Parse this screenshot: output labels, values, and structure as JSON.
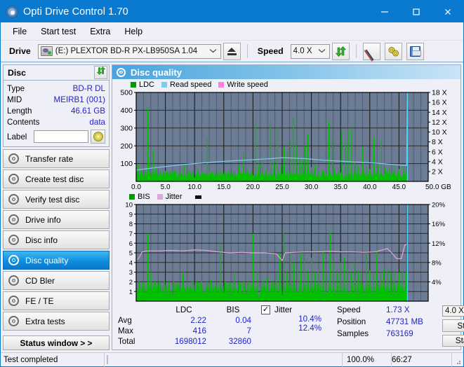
{
  "window": {
    "title": "Opti Drive Control 1.70",
    "icon": "disc-icon",
    "minimize": "–",
    "maximize": "□",
    "close": "✕"
  },
  "menu": {
    "items": [
      {
        "label": "File"
      },
      {
        "label": "Start test"
      },
      {
        "label": "Extra"
      },
      {
        "label": "Help"
      }
    ]
  },
  "toolbar": {
    "drive_label": "Drive",
    "drive_value": "(E:)   PLEXTOR BD-R  PX-LB950SA 1.04",
    "eject_icon": "eject-icon",
    "speed_label": "Speed",
    "speed_value": "4.0 X",
    "refresh_icon": "refresh-icon",
    "eraser_icon": "eraser-icon",
    "tools_icon": "gears-icon",
    "save_icon": "save-icon",
    "chevron": "⌄"
  },
  "sidebar": {
    "disc_panel": {
      "title": "Disc",
      "refresh_icon": "refresh-icon",
      "rows": [
        {
          "key": "Type",
          "value": "BD-R DL"
        },
        {
          "key": "MID",
          "value": "MEIRB1 (001)"
        },
        {
          "key": "Length",
          "value": "46.61 GB"
        },
        {
          "key": "Contents",
          "value": "data"
        }
      ],
      "label_key": "Label",
      "label_value": "",
      "label_placeholder": "",
      "cd_icon": "cd-icon"
    },
    "nav": [
      {
        "label": "Transfer rate",
        "icon": "disc-icon",
        "active": false
      },
      {
        "label": "Create test disc",
        "icon": "disc-icon",
        "active": false
      },
      {
        "label": "Verify test disc",
        "icon": "disc-icon",
        "active": false
      },
      {
        "label": "Drive info",
        "icon": "disc-icon",
        "active": false
      },
      {
        "label": "Disc info",
        "icon": "disc-icon",
        "active": false
      },
      {
        "label": "Disc quality",
        "icon": "disc-icon",
        "active": true
      },
      {
        "label": "CD Bler",
        "icon": "disc-icon",
        "active": false
      },
      {
        "label": "FE / TE",
        "icon": "disc-icon",
        "active": false
      },
      {
        "label": "Extra tests",
        "icon": "disc-icon",
        "active": false
      }
    ],
    "status_window": "Status window > >"
  },
  "main": {
    "title": "Disc quality",
    "icon": "disc-icon"
  },
  "stats": {
    "columns": [
      "LDC",
      "BIS"
    ],
    "rows": [
      {
        "key": "Avg",
        "ldc": "2.22",
        "bis": "0.04"
      },
      {
        "key": "Max",
        "ldc": "416",
        "bis": "7"
      },
      {
        "key": "Total",
        "ldc": "1698012",
        "bis": "32860"
      }
    ],
    "jitter": {
      "checked": true,
      "check_glyph": "✓",
      "label": "Jitter",
      "avg": "10.4%",
      "max": "12.4%"
    },
    "right": [
      {
        "key": "Speed",
        "value": "1.73 X"
      },
      {
        "key": "Position",
        "value": "47731 MB"
      },
      {
        "key": "Samples",
        "value": "763169"
      }
    ],
    "speed_select": "4.0 X",
    "speed_chevron": "⌄",
    "start_full": "Start full",
    "start_part": "Start part"
  },
  "statusbar": {
    "text": "Test completed",
    "percent_label": "100.0%",
    "percent_value": 100,
    "time": "66:27"
  },
  "chart_data": [
    {
      "type": "area",
      "name": "ldc-chart",
      "title": "",
      "xlabel": "GB",
      "ylabel": "",
      "xlim": [
        0,
        50
      ],
      "ylim": [
        0,
        500
      ],
      "xticks": [
        "0.0",
        "5.0",
        "10.0",
        "15.0",
        "20.0",
        "25.0",
        "30.0",
        "35.0",
        "40.0",
        "45.0",
        "50.0 GB"
      ],
      "yticks": [
        "100",
        "200",
        "300",
        "400",
        "500"
      ],
      "y2lim": [
        0,
        18
      ],
      "y2ticks": [
        "2 X",
        "4 X",
        "6 X",
        "8 X",
        "10 X",
        "12 X",
        "14 X",
        "16 X",
        "18 X"
      ],
      "grid": true,
      "legend_position": "top",
      "legend": [
        {
          "name": "LDC",
          "color": "#009900"
        },
        {
          "name": "Read speed",
          "color": "#7ecbf0"
        },
        {
          "name": "Write speed",
          "color": "#ff7fe0"
        }
      ],
      "series": [
        {
          "name": "LDC",
          "color": "#00c000",
          "kind": "spikes",
          "baseline": 30,
          "peaks": [
            [
              0.3,
              95
            ],
            [
              0.8,
              60
            ],
            [
              1.4,
              70
            ],
            [
              2.0,
              415
            ],
            [
              2.3,
              120
            ],
            [
              2.9,
              180
            ],
            [
              3.4,
              75
            ],
            [
              4.1,
              55
            ],
            [
              5.0,
              60
            ],
            [
              5.8,
              50
            ],
            [
              6.6,
              65
            ],
            [
              7.4,
              45
            ],
            [
              8.2,
              90
            ],
            [
              9.0,
              55
            ],
            [
              9.8,
              60
            ],
            [
              10.6,
              70
            ],
            [
              11.4,
              50
            ],
            [
              12.2,
              245
            ],
            [
              12.9,
              60
            ],
            [
              13.6,
              55
            ],
            [
              14.4,
              70
            ],
            [
              15.2,
              50
            ],
            [
              16.0,
              60
            ],
            [
              16.8,
              55
            ],
            [
              17.6,
              95
            ],
            [
              18.4,
              160
            ],
            [
              19.0,
              70
            ],
            [
              19.7,
              60
            ],
            [
              20.4,
              330
            ],
            [
              21.0,
              100
            ],
            [
              21.6,
              120
            ],
            [
              22.2,
              60
            ],
            [
              23.0,
              345
            ],
            [
              23.6,
              110
            ],
            [
              24.2,
              300
            ],
            [
              24.8,
              90
            ],
            [
              25.3,
              190
            ],
            [
              25.9,
              170
            ],
            [
              26.4,
              230
            ],
            [
              26.9,
              360
            ],
            [
              27.4,
              210
            ],
            [
              28.0,
              150
            ],
            [
              28.4,
              115
            ],
            [
              28.9,
              200
            ],
            [
              29.4,
              265
            ],
            [
              30.0,
              80
            ],
            [
              30.6,
              90
            ],
            [
              31.2,
              70
            ],
            [
              32.0,
              60
            ],
            [
              33.0,
              340
            ],
            [
              33.6,
              240
            ],
            [
              34.0,
              70
            ],
            [
              34.6,
              70
            ],
            [
              35.2,
              285
            ],
            [
              35.8,
              215
            ],
            [
              36.3,
              290
            ],
            [
              36.9,
              295
            ],
            [
              37.4,
              120
            ],
            [
              38.0,
              90
            ],
            [
              38.8,
              190
            ],
            [
              39.4,
              80
            ],
            [
              40.0,
              70
            ],
            [
              40.7,
              250
            ],
            [
              41.4,
              90
            ],
            [
              42.0,
              240
            ],
            [
              42.6,
              80
            ],
            [
              43.4,
              80
            ],
            [
              44.2,
              100
            ],
            [
              45.0,
              70
            ],
            [
              45.8,
              90
            ],
            [
              46.3,
              60
            ]
          ]
        },
        {
          "name": "Read speed",
          "color": "#7ecbf0",
          "kind": "line",
          "points": [
            [
              0.0,
              2.3
            ],
            [
              2.0,
              2.6
            ],
            [
              5.0,
              3.0
            ],
            [
              8.0,
              3.4
            ],
            [
              11.0,
              3.7
            ],
            [
              14.0,
              4.0
            ],
            [
              17.0,
              4.2
            ],
            [
              20.0,
              4.4
            ],
            [
              23.0,
              4.6
            ],
            [
              25.0,
              4.8
            ],
            [
              27.0,
              4.7
            ],
            [
              29.0,
              4.6
            ],
            [
              32.0,
              4.3
            ],
            [
              35.0,
              4.1
            ],
            [
              38.0,
              3.9
            ],
            [
              41.0,
              3.7
            ],
            [
              44.0,
              3.4
            ],
            [
              46.3,
              3.2
            ],
            [
              46.4,
              18.0
            ]
          ]
        }
      ]
    },
    {
      "type": "area",
      "name": "bis-jitter-chart",
      "title": "",
      "xlabel": "GB",
      "ylabel": "",
      "xlim": [
        0,
        50
      ],
      "ylim": [
        0,
        10
      ],
      "xticks": [
        "0.0",
        "5.0",
        "10.0",
        "15.0",
        "20.0",
        "25.0",
        "30.0",
        "35.0",
        "40.0",
        "45.0",
        "50.0 GB"
      ],
      "yticks": [
        "1",
        "2",
        "3",
        "4",
        "5",
        "6",
        "7",
        "8",
        "9",
        "10"
      ],
      "y2lim": [
        0,
        20
      ],
      "y2ticks": [
        "4%",
        "8%",
        "12%",
        "16%",
        "20%"
      ],
      "grid": true,
      "legend_position": "top",
      "legend": [
        {
          "name": "BIS",
          "color": "#009900"
        },
        {
          "name": "Jitter",
          "color": "#e0a8d8"
        }
      ],
      "series": [
        {
          "name": "BIS",
          "color": "#00c000",
          "kind": "spikes",
          "baseline": 1.05,
          "peaks": [
            [
              0.5,
              2.1
            ],
            [
              1.2,
              2.0
            ],
            [
              2.0,
              7.0
            ],
            [
              2.5,
              3.0
            ],
            [
              3.2,
              2.1
            ],
            [
              4.0,
              2.0
            ],
            [
              4.8,
              2.2
            ],
            [
              5.6,
              2.0
            ],
            [
              6.4,
              2.1
            ],
            [
              7.2,
              2.0
            ],
            [
              8.0,
              3.0
            ],
            [
              8.8,
              2.0
            ],
            [
              9.6,
              2.2
            ],
            [
              10.4,
              2.0
            ],
            [
              11.2,
              2.1
            ],
            [
              12.0,
              2.0
            ],
            [
              12.8,
              2.2
            ],
            [
              13.6,
              2.0
            ],
            [
              14.4,
              6.0
            ],
            [
              15.2,
              2.1
            ],
            [
              16.0,
              2.0
            ],
            [
              16.8,
              3.0
            ],
            [
              17.6,
              2.0
            ],
            [
              18.4,
              2.2
            ],
            [
              19.2,
              2.0
            ],
            [
              20.0,
              7.0
            ],
            [
              20.8,
              3.0
            ],
            [
              21.6,
              2.1
            ],
            [
              22.4,
              2.5
            ],
            [
              23.2,
              2.0
            ],
            [
              24.0,
              3.0
            ],
            [
              24.6,
              5.0
            ],
            [
              25.2,
              7.2
            ],
            [
              25.8,
              3.0
            ],
            [
              26.4,
              5.2
            ],
            [
              27.0,
              4.0
            ],
            [
              27.6,
              3.2
            ],
            [
              28.2,
              5.0
            ],
            [
              28.8,
              4.2
            ],
            [
              29.4,
              3.0
            ],
            [
              30.0,
              4.5
            ],
            [
              30.6,
              3.0
            ],
            [
              31.2,
              3.2
            ],
            [
              32.0,
              5.2
            ],
            [
              32.6,
              3.0
            ],
            [
              33.2,
              7.2
            ],
            [
              33.8,
              4.0
            ],
            [
              34.4,
              3.0
            ],
            [
              35.0,
              4.0
            ],
            [
              35.6,
              4.5
            ],
            [
              36.2,
              3.5
            ],
            [
              36.8,
              3.0
            ],
            [
              37.4,
              4.0
            ],
            [
              38.0,
              3.2
            ],
            [
              38.6,
              3.0
            ],
            [
              39.4,
              5.0
            ],
            [
              40.0,
              3.2
            ],
            [
              40.6,
              3.0
            ],
            [
              41.2,
              5.2
            ],
            [
              41.8,
              3.0
            ],
            [
              42.4,
              3.2
            ],
            [
              43.0,
              3.5
            ],
            [
              43.6,
              3.0
            ],
            [
              44.2,
              3.2
            ],
            [
              45.0,
              3.0
            ],
            [
              45.6,
              3.2
            ],
            [
              46.2,
              3.0
            ]
          ],
          "fill_to": 1.45
        },
        {
          "name": "Jitter",
          "color": "#e0a8d8",
          "kind": "line",
          "points": [
            [
              0.2,
              4.3
            ],
            [
              0.6,
              4.6
            ],
            [
              1.0,
              5.1
            ],
            [
              2.0,
              5.2
            ],
            [
              4.0,
              5.2
            ],
            [
              6.0,
              5.25
            ],
            [
              8.0,
              5.2
            ],
            [
              10.0,
              5.3
            ],
            [
              12.0,
              5.25
            ],
            [
              14.0,
              5.1
            ],
            [
              16.0,
              5.0
            ],
            [
              18.0,
              5.05
            ],
            [
              20.0,
              5.0
            ],
            [
              22.0,
              5.0
            ],
            [
              24.0,
              4.9
            ],
            [
              25.0,
              4.2
            ],
            [
              25.5,
              5.0
            ],
            [
              27.0,
              5.05
            ],
            [
              29.0,
              5.1
            ],
            [
              31.0,
              5.1
            ],
            [
              33.0,
              5.15
            ],
            [
              35.0,
              5.1
            ],
            [
              37.0,
              5.1
            ],
            [
              39.0,
              5.05
            ],
            [
              41.0,
              5.1
            ],
            [
              43.0,
              5.45
            ],
            [
              43.6,
              5.1
            ],
            [
              44.6,
              4.4
            ],
            [
              45.4,
              4.4
            ],
            [
              46.0,
              5.8
            ],
            [
              46.3,
              5.9
            ]
          ]
        }
      ]
    }
  ]
}
